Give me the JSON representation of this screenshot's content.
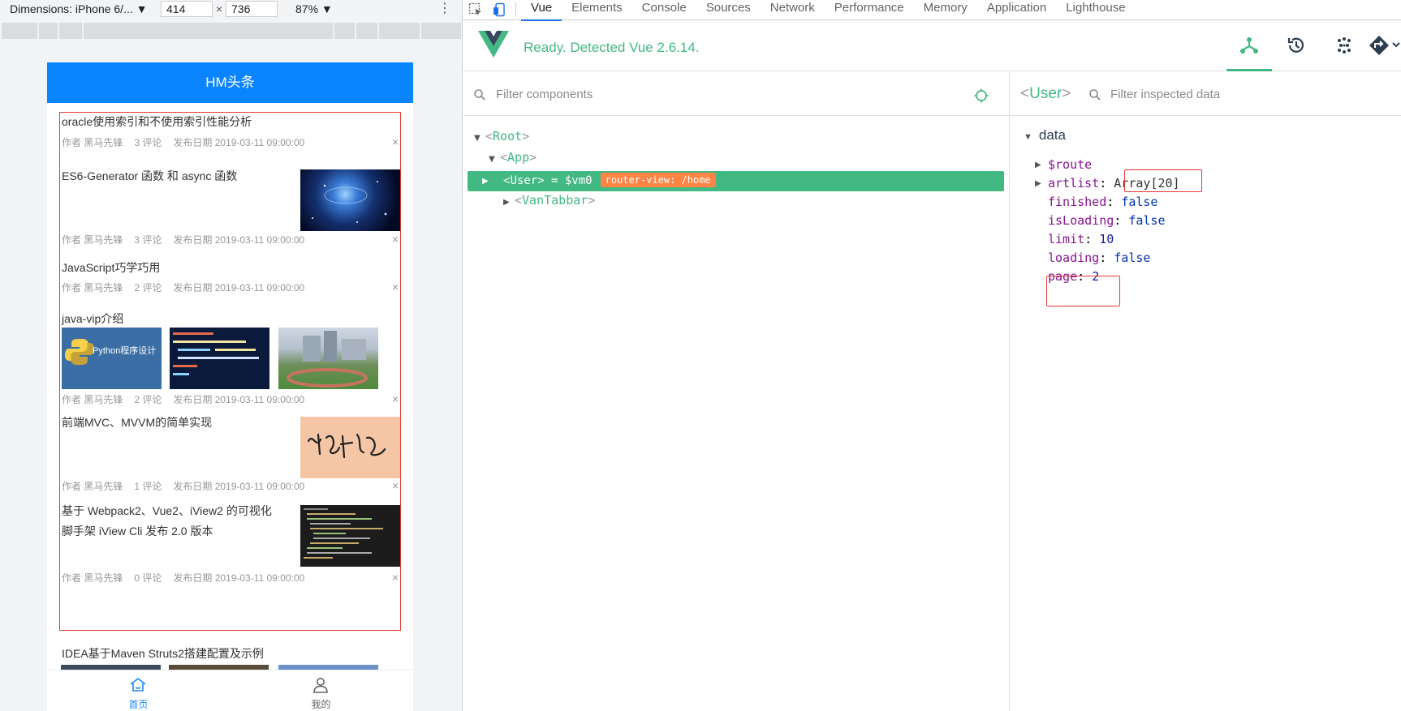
{
  "device_toolbar": {
    "dimensions_label": "Dimensions: iPhone 6/... ▼",
    "width": "414",
    "height": "736",
    "zoom": "87% ▼",
    "more": "⋮"
  },
  "phone": {
    "header_title": "HM头条",
    "articles": [
      {
        "title": "oracle使用索引和不使用索引性能分析",
        "author": "作者 黑马先锋",
        "comments": "3 评论",
        "date": "发布日期 2019-03-11 09:00:00"
      },
      {
        "title": "ES6-Generator 函数 和 async 函数",
        "author": "作者 黑马先锋",
        "comments": "3 评论",
        "date": "发布日期 2019-03-11 09:00:00"
      },
      {
        "title": "JavaScript巧学巧用",
        "author": "作者 黑马先锋",
        "comments": "2 评论",
        "date": "发布日期 2019-03-11 09:00:00"
      },
      {
        "title": "java-vip介绍",
        "author": "作者 黑马先锋",
        "comments": "2 评论",
        "date": "发布日期 2019-03-11 09:00:00",
        "thumb1_text": "Python程序设计"
      },
      {
        "title": "前端MVC、MVVM的简单实现",
        "author": "作者 黑马先锋",
        "comments": "1 评论",
        "date": "发布日期 2019-03-11 09:00:00"
      },
      {
        "title_line1": "基于 Webpack2、Vue2、iView2 的可视化",
        "title_line2": "脚手架 iView Cli 发布 2.0 版本",
        "author": "作者 黑马先锋",
        "comments": "0 评论",
        "date": "发布日期 2019-03-11 09:00:00"
      }
    ],
    "next_title": "IDEA基于Maven Struts2搭建配置及示例",
    "close_glyph": "×",
    "tabs": [
      {
        "label": "首页",
        "icon": "home-icon",
        "active": true
      },
      {
        "label": "我的",
        "icon": "user-icon",
        "active": false
      }
    ]
  },
  "devtools": {
    "tabs": [
      "Vue",
      "Elements",
      "Console",
      "Sources",
      "Network",
      "Performance",
      "Memory",
      "Application",
      "Lighthouse"
    ],
    "active_tab": "Vue",
    "status": "Ready. Detected Vue 2.6.14.",
    "filter_components_placeholder": "Filter components",
    "filter_data_placeholder": "Filter inspected data",
    "tree": {
      "root": "Root",
      "app": "App",
      "user": "User",
      "user_suffix": " = $vm0",
      "router_badge": "router-view: /home",
      "tabbar": "VanTabbar"
    },
    "inspected": {
      "component": "User",
      "section": "data",
      "props": [
        {
          "key": "$route",
          "value": "",
          "type": "obj",
          "expandable": true
        },
        {
          "key": "artlist",
          "value": "Array[20]",
          "type": "obj",
          "expandable": true
        },
        {
          "key": "finished",
          "value": "false",
          "type": "bool"
        },
        {
          "key": "isLoading",
          "value": "false",
          "type": "bool"
        },
        {
          "key": "limit",
          "value": "10",
          "type": "num"
        },
        {
          "key": "loading",
          "value": "false",
          "type": "bool"
        },
        {
          "key": "page",
          "value": "2",
          "type": "num"
        }
      ]
    }
  },
  "colors": {
    "vue_green": "#42b883",
    "phone_header": "#0a84ff",
    "highlight_red": "#e53935",
    "badge_orange": "#ff8344"
  }
}
